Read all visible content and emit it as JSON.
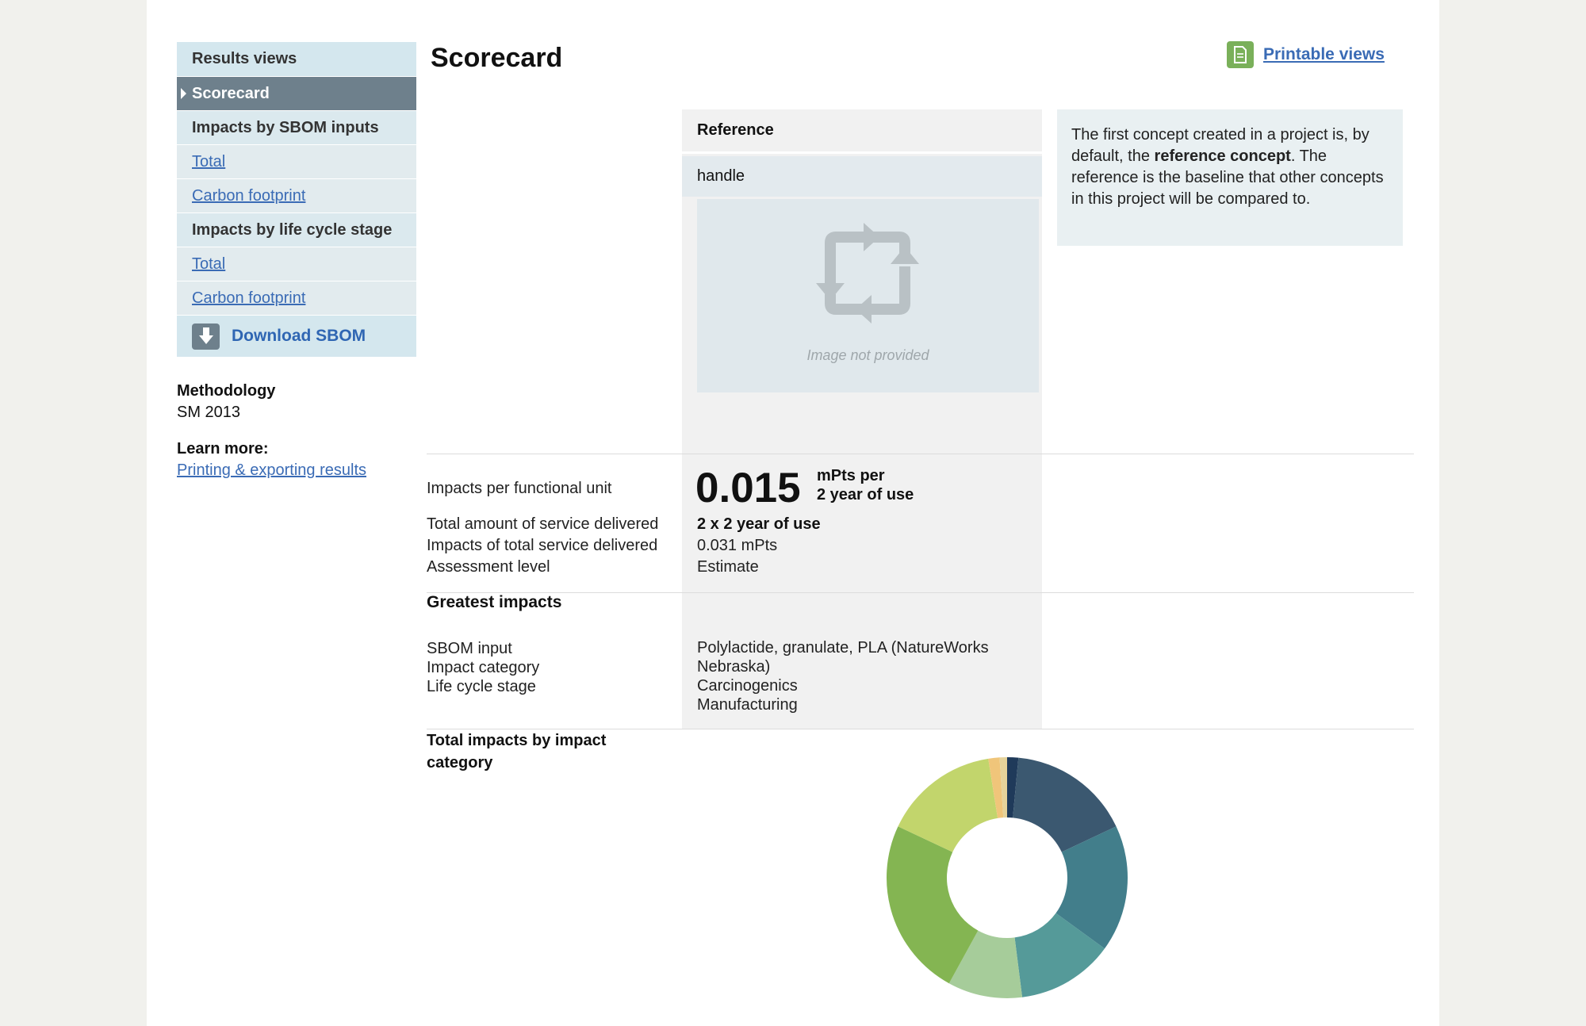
{
  "sidebar": {
    "results_views": "Results views",
    "scorecard": "Scorecard",
    "sbom_inputs_head": "Impacts by SBOM inputs",
    "sbom_total": "Total",
    "sbom_carbon": "Carbon footprint",
    "lifecycle_head": "Impacts by life cycle stage",
    "lc_total": "Total",
    "lc_carbon": "Carbon footprint",
    "download": "Download SBOM"
  },
  "methodology": {
    "label": "Methodology",
    "value": "SM 2013"
  },
  "learn_more": {
    "label": "Learn more:",
    "link": "Printing & exporting results"
  },
  "header": {
    "title": "Scorecard",
    "printable": "Printable views"
  },
  "reference": {
    "head": "Reference",
    "name": "handle",
    "image_caption": "Image not provided"
  },
  "info": {
    "part1": "The first concept created in a project is, by default, the ",
    "bold": "reference concept",
    "part2": ". The reference is the baseline that other concepts in this project will be compared to."
  },
  "metrics": {
    "impacts_per_fu_label": "Impacts per functional unit",
    "impacts_per_fu_value": "0.015",
    "unit_line1": "mPts per",
    "unit_line2": "2 year of use",
    "total_service_label": "Total amount of service delivered",
    "total_service_value": "2 x 2 year of use",
    "impacts_total_label": "Impacts of total service delivered",
    "impacts_total_value": "0.031 mPts",
    "assessment_label": "Assessment level",
    "assessment_value": "Estimate"
  },
  "greatest": {
    "title": "Greatest impacts",
    "sbom_label": "SBOM input",
    "category_label": "Impact category",
    "stage_label": "Life cycle stage",
    "sbom_value_line1": "Polylactide, granulate, PLA (NatureWorks",
    "sbom_value_line2": "Nebraska)",
    "category_value": "Carcinogenics",
    "stage_value": "Manufacturing"
  },
  "donut": {
    "title_line1": "Total impacts by impact",
    "title_line2": "category"
  },
  "chart_data": {
    "type": "pie",
    "title": "",
    "slices": [
      {
        "value": 1.5,
        "color": "#1f3a5a"
      },
      {
        "value": 16.5,
        "color": "#3b5870"
      },
      {
        "value": 17.0,
        "color": "#427e8b"
      },
      {
        "value": 13.0,
        "color": "#559a99"
      },
      {
        "value": 10.0,
        "color": "#a6cc9a"
      },
      {
        "value": 24.0,
        "color": "#84b552"
      },
      {
        "value": 15.5,
        "color": "#c2d56c"
      },
      {
        "value": 1.5,
        "color": "#f0c57a"
      },
      {
        "value": 1.0,
        "color": "#e6d39a"
      }
    ]
  }
}
